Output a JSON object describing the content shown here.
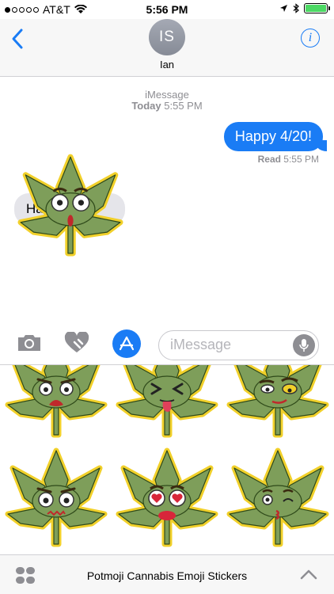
{
  "status_bar": {
    "carrier": "AT&T",
    "time": "5:56 PM"
  },
  "header": {
    "avatar_initials": "IS",
    "contact_name": "Ian",
    "info_label": "i"
  },
  "conversation": {
    "service": "iMessage",
    "day": "Today",
    "day_time": "5:55 PM",
    "outgoing_text": "Happy 4/20!",
    "read_label": "Read",
    "read_time": "5:55 PM",
    "incoming_text": "Happy 4/20!"
  },
  "input_bar": {
    "placeholder": "iMessage"
  },
  "sticker_tray": {
    "stickers": [
      "crying",
      "winking-tongue",
      "smirk",
      "worried",
      "heart-eyes",
      "kissing"
    ]
  },
  "bottom_bar": {
    "app_title": "Potmoji Cannabis Emoji Stickers"
  },
  "colors": {
    "accent": "#1a7cf5",
    "leaf_fill": "#7e9e5a",
    "leaf_outline": "#f1d02a",
    "bubble_gray": "#e5e5ea"
  },
  "icons": [
    "back-chevron-icon",
    "info-icon",
    "camera-icon",
    "digital-touch-heart-icon",
    "app-store-icon",
    "microphone-icon",
    "app-drawer-icon",
    "chevron-up-icon",
    "location-arrow-icon",
    "bluetooth-icon",
    "wifi-icon",
    "battery-icon"
  ]
}
